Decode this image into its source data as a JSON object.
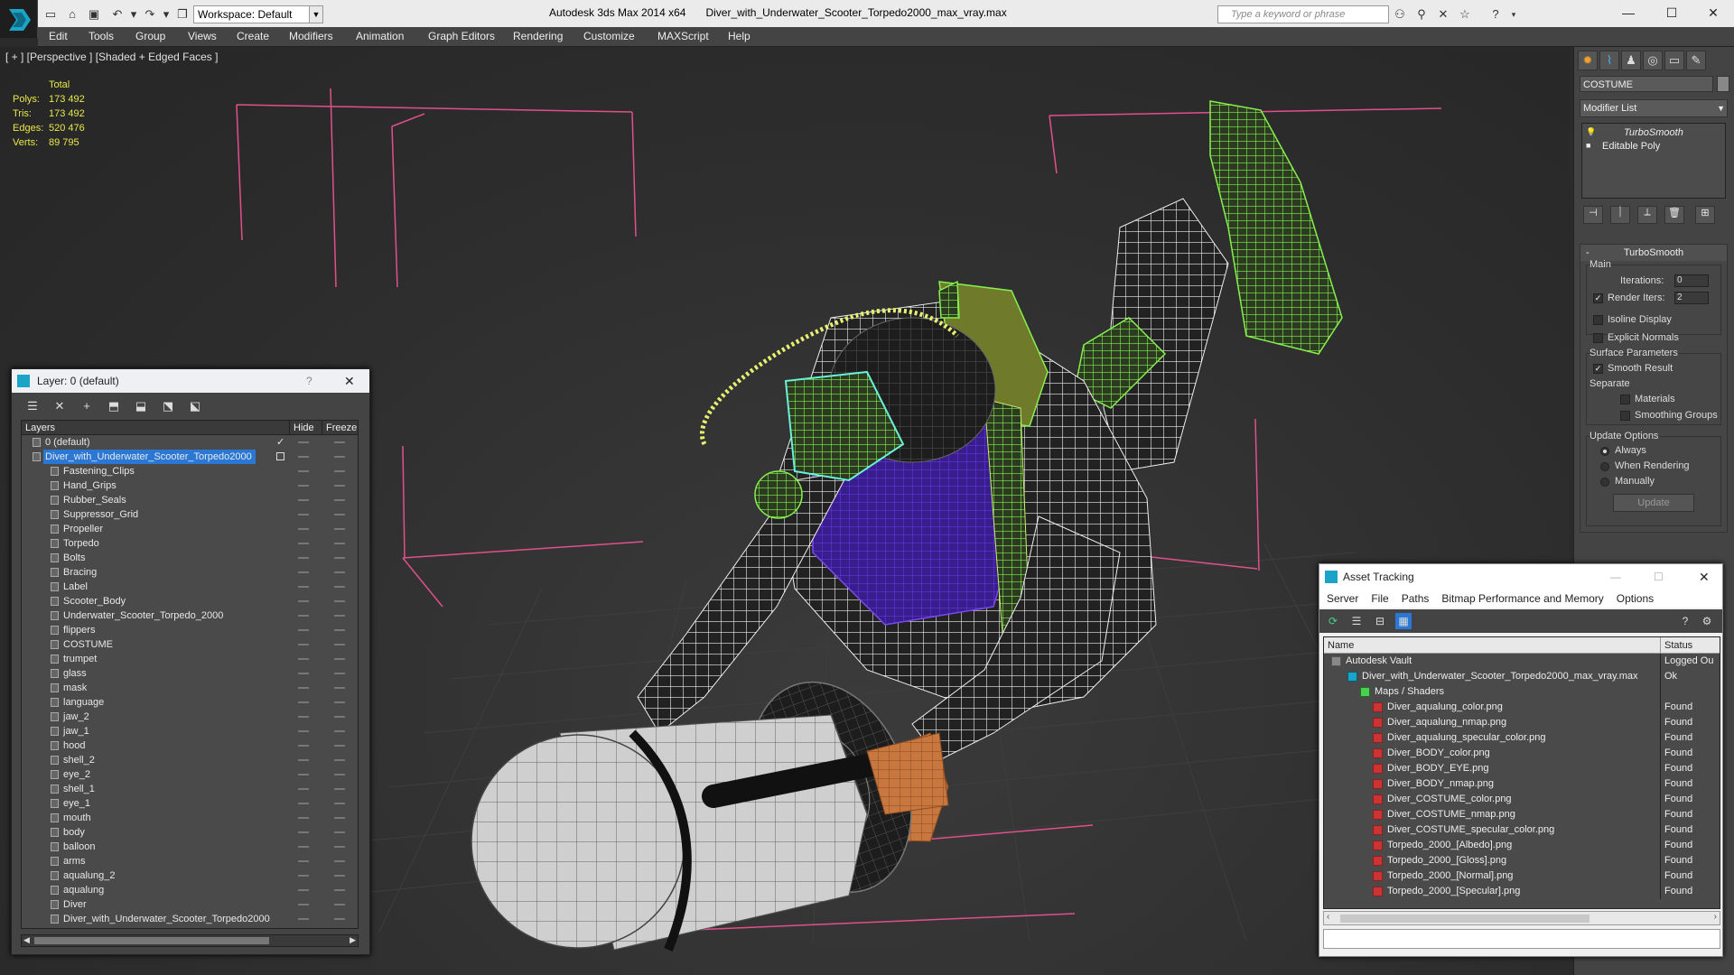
{
  "app": {
    "title": "Autodesk 3ds Max  2014 x64",
    "file": "Diver_with_Underwater_Scooter_Torpedo2000_max_vray.max",
    "workspace": "Workspace: Default",
    "search_placeholder": "Type a keyword or phrase"
  },
  "menu": [
    "Edit",
    "Tools",
    "Group",
    "Views",
    "Create",
    "Modifiers",
    "Animation",
    "Graph Editors",
    "Rendering",
    "Customize",
    "MAXScript",
    "Help"
  ],
  "viewport": {
    "label": "[ + ] [Perspective ] [Shaded + Edged Faces ]",
    "stats_header": "Total",
    "stats": [
      {
        "k": "Polys:",
        "v": "173 492"
      },
      {
        "k": "Tris:",
        "v": "173 492"
      },
      {
        "k": "Edges:",
        "v": "520 476"
      },
      {
        "k": "Verts:",
        "v": "89 795"
      }
    ]
  },
  "command_panel": {
    "object_name": "COSTUME",
    "modifier_list": "Modifier List",
    "stack": [
      "TurboSmooth",
      "Editable Poly"
    ],
    "rollout_title": "TurboSmooth",
    "main_group": "Main",
    "iterations_label": "Iterations:",
    "iterations_value": "0",
    "render_iters_label": "Render Iters:",
    "render_iters_value": "2",
    "isoline": "Isoline Display",
    "explicit_normals": "Explicit Normals",
    "surface_group": "Surface Parameters",
    "smooth_result": "Smooth Result",
    "separate": "Separate",
    "materials": "Materials",
    "smoothing_groups": "Smoothing Groups",
    "update_group": "Update Options",
    "always": "Always",
    "when_rendering": "When Rendering",
    "manually": "Manually",
    "update_btn": "Update"
  },
  "layer_window": {
    "title": "Layer: 0 (default)",
    "help": "?",
    "col_layers": "Layers",
    "col_hide": "Hide",
    "col_freeze": "Freeze",
    "rows": [
      {
        "name": "0 (default)",
        "level": 0,
        "check": true
      },
      {
        "name": "Diver_with_Underwater_Scooter_Torpedo2000",
        "level": 0,
        "selected": true
      },
      {
        "name": "Fastening_Clips",
        "level": 1
      },
      {
        "name": "Hand_Grips",
        "level": 1
      },
      {
        "name": "Rubber_Seals",
        "level": 1
      },
      {
        "name": "Suppressor_Grid",
        "level": 1
      },
      {
        "name": "Propeller",
        "level": 1
      },
      {
        "name": "Torpedo",
        "level": 1
      },
      {
        "name": "Bolts",
        "level": 1
      },
      {
        "name": "Bracing",
        "level": 1
      },
      {
        "name": "Label",
        "level": 1
      },
      {
        "name": "Scooter_Body",
        "level": 1
      },
      {
        "name": "Underwater_Scooter_Torpedo_2000",
        "level": 1
      },
      {
        "name": "flippers",
        "level": 1
      },
      {
        "name": "COSTUME",
        "level": 1
      },
      {
        "name": "trumpet",
        "level": 1
      },
      {
        "name": "glass",
        "level": 1
      },
      {
        "name": "mask",
        "level": 1
      },
      {
        "name": "language",
        "level": 1
      },
      {
        "name": "jaw_2",
        "level": 1
      },
      {
        "name": "jaw_1",
        "level": 1
      },
      {
        "name": "hood",
        "level": 1
      },
      {
        "name": "shell_2",
        "level": 1
      },
      {
        "name": "eye_2",
        "level": 1
      },
      {
        "name": "shell_1",
        "level": 1
      },
      {
        "name": "eye_1",
        "level": 1
      },
      {
        "name": "mouth",
        "level": 1
      },
      {
        "name": "body",
        "level": 1
      },
      {
        "name": "balloon",
        "level": 1
      },
      {
        "name": "arms",
        "level": 1
      },
      {
        "name": "aqualung_2",
        "level": 1
      },
      {
        "name": "aqualung",
        "level": 1
      },
      {
        "name": "Diver",
        "level": 1
      },
      {
        "name": "Diver_with_Underwater_Scooter_Torpedo2000",
        "level": 1
      }
    ]
  },
  "asset_window": {
    "title": "Asset Tracking",
    "menu": [
      "Server",
      "File",
      "Paths",
      "Bitmap Performance and Memory",
      "Options"
    ],
    "col_name": "Name",
    "col_status": "Status",
    "rows": [
      {
        "name": "Autodesk Vault",
        "status": "Logged Ou",
        "level": 0
      },
      {
        "name": "Diver_with_Underwater_Scooter_Torpedo2000_max_vray.max",
        "status": "Ok",
        "level": 1
      },
      {
        "name": "Maps / Shaders",
        "status": "",
        "level": 2
      },
      {
        "name": "Diver_aqualung_color.png",
        "status": "Found",
        "level": 3
      },
      {
        "name": "Diver_aqualung_nmap.png",
        "status": "Found",
        "level": 3
      },
      {
        "name": "Diver_aqualung_specular_color.png",
        "status": "Found",
        "level": 3
      },
      {
        "name": "Diver_BODY_color.png",
        "status": "Found",
        "level": 3
      },
      {
        "name": "Diver_BODY_EYE.png",
        "status": "Found",
        "level": 3
      },
      {
        "name": "Diver_BODY_nmap.png",
        "status": "Found",
        "level": 3
      },
      {
        "name": "Diver_COSTUME_color.png",
        "status": "Found",
        "level": 3
      },
      {
        "name": "Diver_COSTUME_nmap.png",
        "status": "Found",
        "level": 3
      },
      {
        "name": "Diver_COSTUME_specular_color.png",
        "status": "Found",
        "level": 3
      },
      {
        "name": "Torpedo_2000_[Albedo].png",
        "status": "Found",
        "level": 3
      },
      {
        "name": "Torpedo_2000_[Gloss].png",
        "status": "Found",
        "level": 3
      },
      {
        "name": "Torpedo_2000_[Normal].png",
        "status": "Found",
        "level": 3
      },
      {
        "name": "Torpedo_2000_[Specular].png",
        "status": "Found",
        "level": 3
      }
    ]
  },
  "colors": {
    "selection": "#2a78d4",
    "stats_text": "#e8e84a",
    "wire_green": "#7cf04a",
    "wire_purple": "#5a2ad8",
    "pink_lines": "#e0508c"
  }
}
